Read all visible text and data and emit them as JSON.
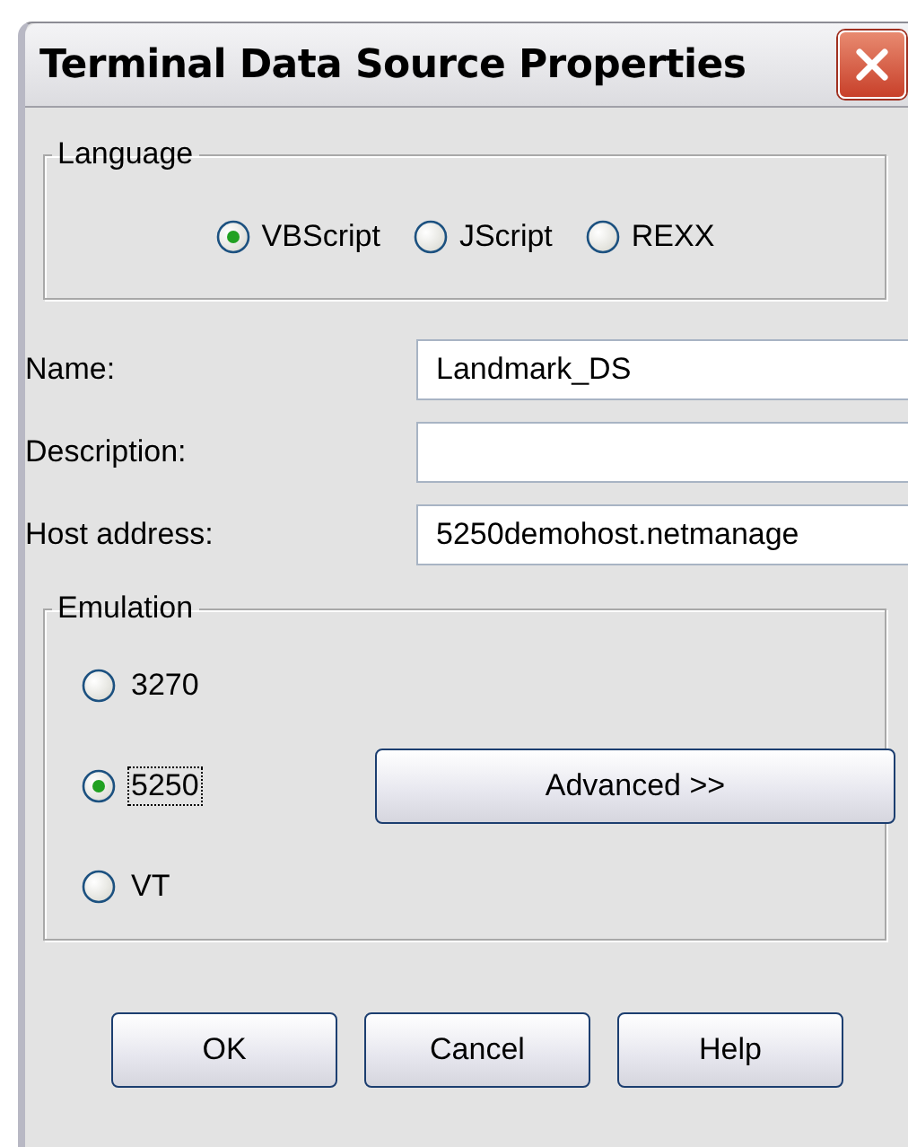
{
  "window": {
    "title": "Terminal Data Source Properties"
  },
  "language": {
    "title": "Language",
    "options": [
      {
        "label": "VBScript",
        "selected": true
      },
      {
        "label": "JScript",
        "selected": false
      },
      {
        "label": "REXX",
        "selected": false
      }
    ]
  },
  "fields": [
    {
      "label": "Name:",
      "value": "Landmark_DS"
    },
    {
      "label": "Description:"
    },
    {
      "label": "Host address:",
      "value": "5250demohost.netmanage"
    }
  ],
  "emulation": {
    "title": "Emulation",
    "options": [
      {
        "label": "3270",
        "selected": false,
        "focused": false
      },
      {
        "label": "5250",
        "selected": true,
        "focused": true
      },
      {
        "label": "VT",
        "selected": false,
        "focused": false
      }
    ],
    "advanced_button": "Advanced >>"
  },
  "buttons": [
    "OK",
    "Cancel",
    "Help"
  ]
}
